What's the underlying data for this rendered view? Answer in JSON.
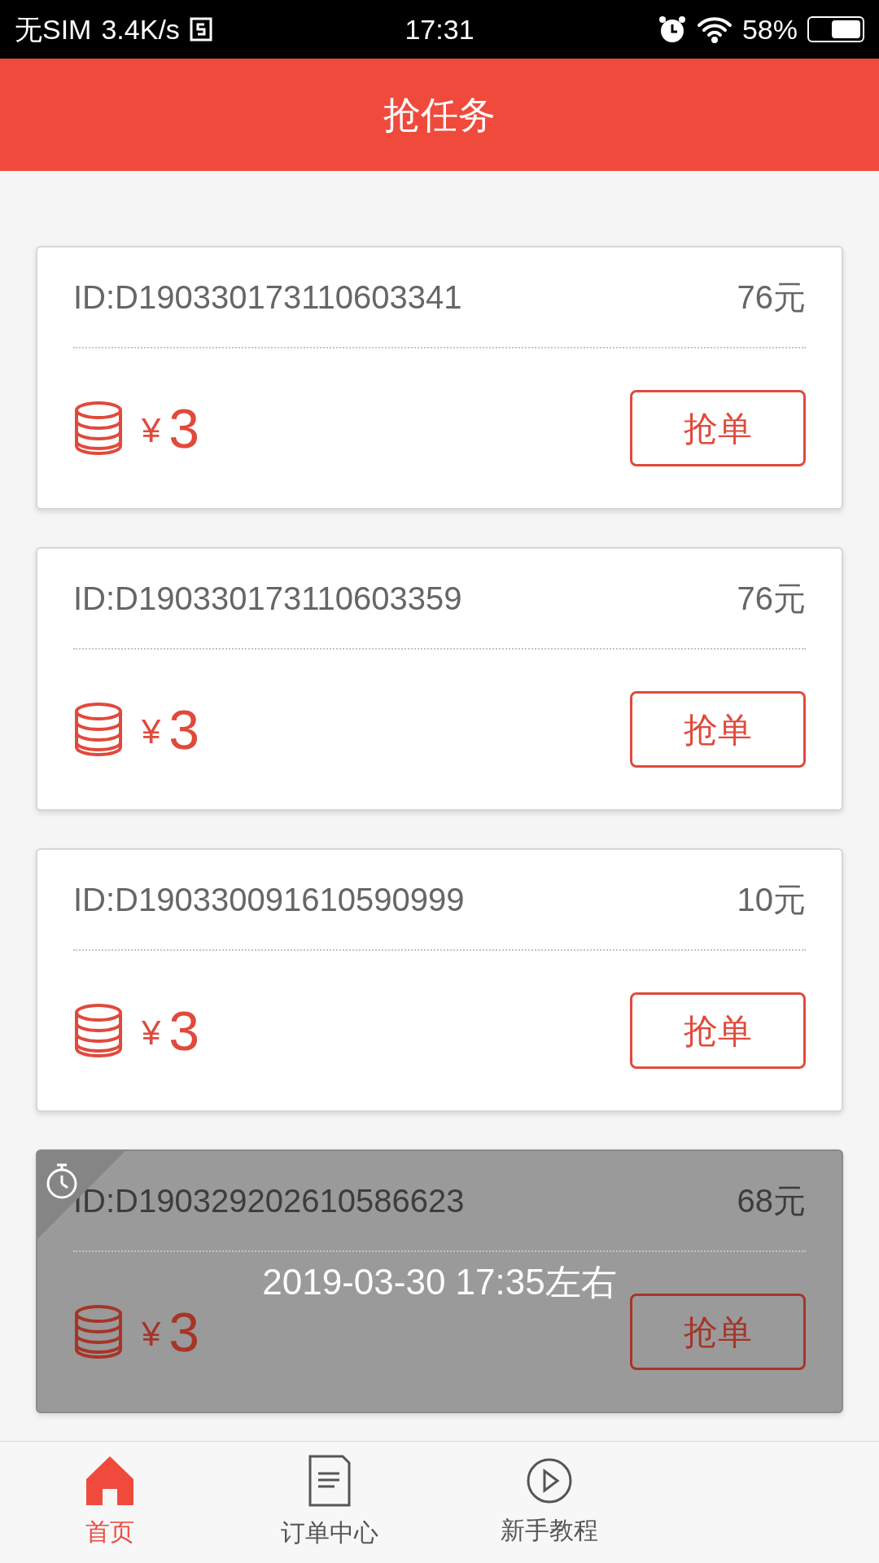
{
  "status_bar": {
    "carrier": "无SIM",
    "speed": "3.4K/s",
    "time": "17:31",
    "battery": "58%"
  },
  "header": {
    "title": "抢任务"
  },
  "tasks": [
    {
      "id": "ID:D190330173110603341",
      "amount": "76元",
      "currency": "¥",
      "reward": "3",
      "button": "抢单",
      "locked": false
    },
    {
      "id": "ID:D190330173110603359",
      "amount": "76元",
      "currency": "¥",
      "reward": "3",
      "button": "抢单",
      "locked": false
    },
    {
      "id": "ID:D190330091610590999",
      "amount": "10元",
      "currency": "¥",
      "reward": "3",
      "button": "抢单",
      "locked": false
    },
    {
      "id": "ID:D190329202610586623",
      "amount": "68元",
      "currency": "¥",
      "reward": "3",
      "button": "抢单",
      "locked": true,
      "unlock_time": "2019-03-30 17:35左右"
    }
  ],
  "tab_bar": [
    {
      "label": "首页",
      "kind": "home",
      "selected": true
    },
    {
      "label": "订单中心",
      "kind": "orders",
      "selected": false
    },
    {
      "label": "新手教程",
      "kind": "tutorial",
      "selected": false
    }
  ]
}
